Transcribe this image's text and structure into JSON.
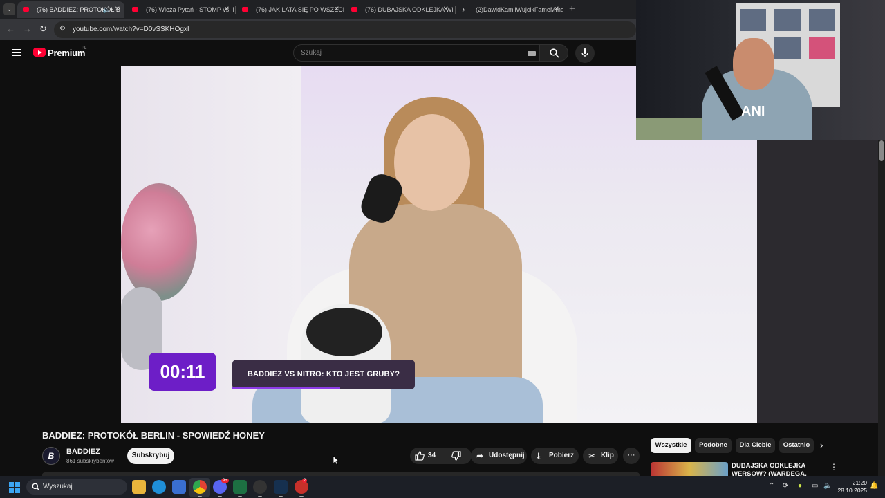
{
  "browser": {
    "tabs": [
      {
        "label": "(76) BADDIEZ: PROTOKÓŁ B",
        "active": true,
        "favicon": "youtube-icon",
        "audio": true
      },
      {
        "label": "(76) Wieża Pytań - STOMP vs. M",
        "active": false,
        "favicon": "youtube-icon"
      },
      {
        "label": "(76) JAK LATA SIĘ PO WSZECH",
        "active": false,
        "favicon": "youtube-icon"
      },
      {
        "label": "(76) DUBAJSKA ODKLEJKA WEF",
        "active": false,
        "favicon": "youtube-icon"
      },
      {
        "label": "(2)DawidKamilWujcikFameMma",
        "active": false,
        "favicon": "tiktok-icon"
      }
    ],
    "new_tab": "+",
    "url": "youtube.com/watch?v=D0vSSKHOgxI"
  },
  "youtube": {
    "logo_text": "Premium",
    "region": "PL",
    "search_placeholder": "Szukaj"
  },
  "video": {
    "timer": "00:11",
    "question": "BADDIEZ VS NITRO: KTO JEST GRUBY?",
    "question_progress": 0.59,
    "watermark": "B"
  },
  "cam": {
    "shirt_text": "ANI"
  },
  "details": {
    "title": "BADDIEZ: PROTOKÓŁ BERLIN - SPOWIEDŹ HONEY",
    "channel_name": "BADDIEZ",
    "channel_avatar": "B",
    "subscribers": "861 subskrybentów",
    "subscribe_label": "Subskrybuj",
    "likes": "34",
    "share_label": "Udostępnij",
    "download_label": "Pobierz",
    "clip_label": "Klip",
    "more_label": "···"
  },
  "recommendations": {
    "chips": [
      "Wszystkie",
      "Podobne",
      "Dla Ciebie",
      "Ostatnio"
    ],
    "selected_chip": "Wszystkie",
    "first_video_title": "DUBAJSKA ODKLEJKA WERSOW? (WARDEGA, NITRO"
  },
  "taskbar": {
    "search_placeholder": "Wyszukaj",
    "time": "21:20",
    "date": "28.10.2025",
    "discord_badge": "9+",
    "app_badge": "2"
  },
  "colors": {
    "youtube_red": "#ff0033",
    "timer_purple": "#6d1ec7",
    "windows_blue": "#3ca5f3"
  }
}
